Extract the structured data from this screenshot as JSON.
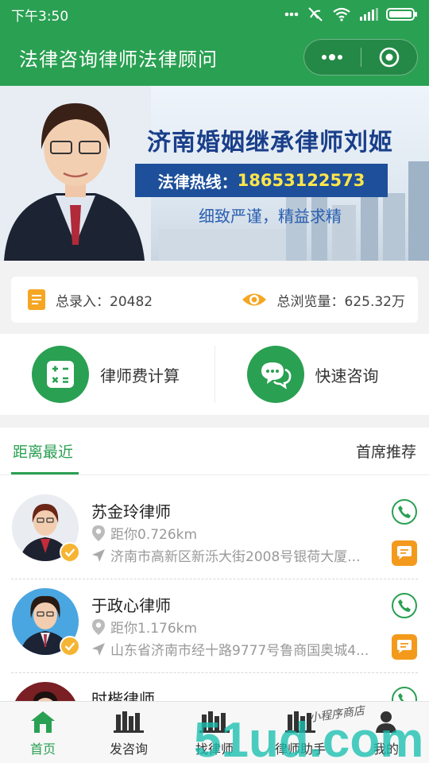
{
  "status": {
    "time": "下午3:50"
  },
  "app": {
    "title": "法律咨询律师法律顾问"
  },
  "banner": {
    "title": "济南婚姻继承律师刘姬",
    "hotline_label": "法律热线：",
    "hotline_number": "18653122573",
    "slogan": "细致严谨，精益求精",
    "slide_count": 9,
    "active_slide": 1
  },
  "stats": {
    "total_entries": "总录入：20482",
    "total_views": "总浏览量：625.32万"
  },
  "quick_actions": [
    {
      "label": "律师费计算",
      "icon": "calculator-icon"
    },
    {
      "label": "快速咨询",
      "icon": "chat-bubbles-icon"
    }
  ],
  "tabs": {
    "left": "距离最近",
    "right": "首席推荐",
    "active": "left"
  },
  "lawyers": [
    {
      "name": "苏金玲律师",
      "distance": "距你0.726km",
      "address": "济南市高新区新泺大街2008号银荷大厦..."
    },
    {
      "name": "于政心律师",
      "distance": "距你1.176km",
      "address": "山东省济南市经十路9777号鲁商国奥城4..."
    },
    {
      "name": "时楷律师",
      "distance": "",
      "address": ""
    }
  ],
  "tabbar": [
    {
      "label": "首页",
      "icon": "home-icon",
      "active": true
    },
    {
      "label": "发咨询",
      "icon": "books-icon",
      "active": false
    },
    {
      "label": "找律师",
      "icon": "books-icon",
      "active": false
    },
    {
      "label": "律师助手",
      "icon": "books-icon",
      "active": false
    },
    {
      "label": "我的",
      "icon": "person-icon",
      "active": false
    }
  ],
  "watermark": {
    "script_text": "小程序商店",
    "brand_text": "51ud.com"
  },
  "colors": {
    "primary": "#2aa052",
    "accent_orange": "#f39a1c",
    "banner_blue": "#1d4f9a",
    "hotline_yellow": "#ffe64a"
  }
}
